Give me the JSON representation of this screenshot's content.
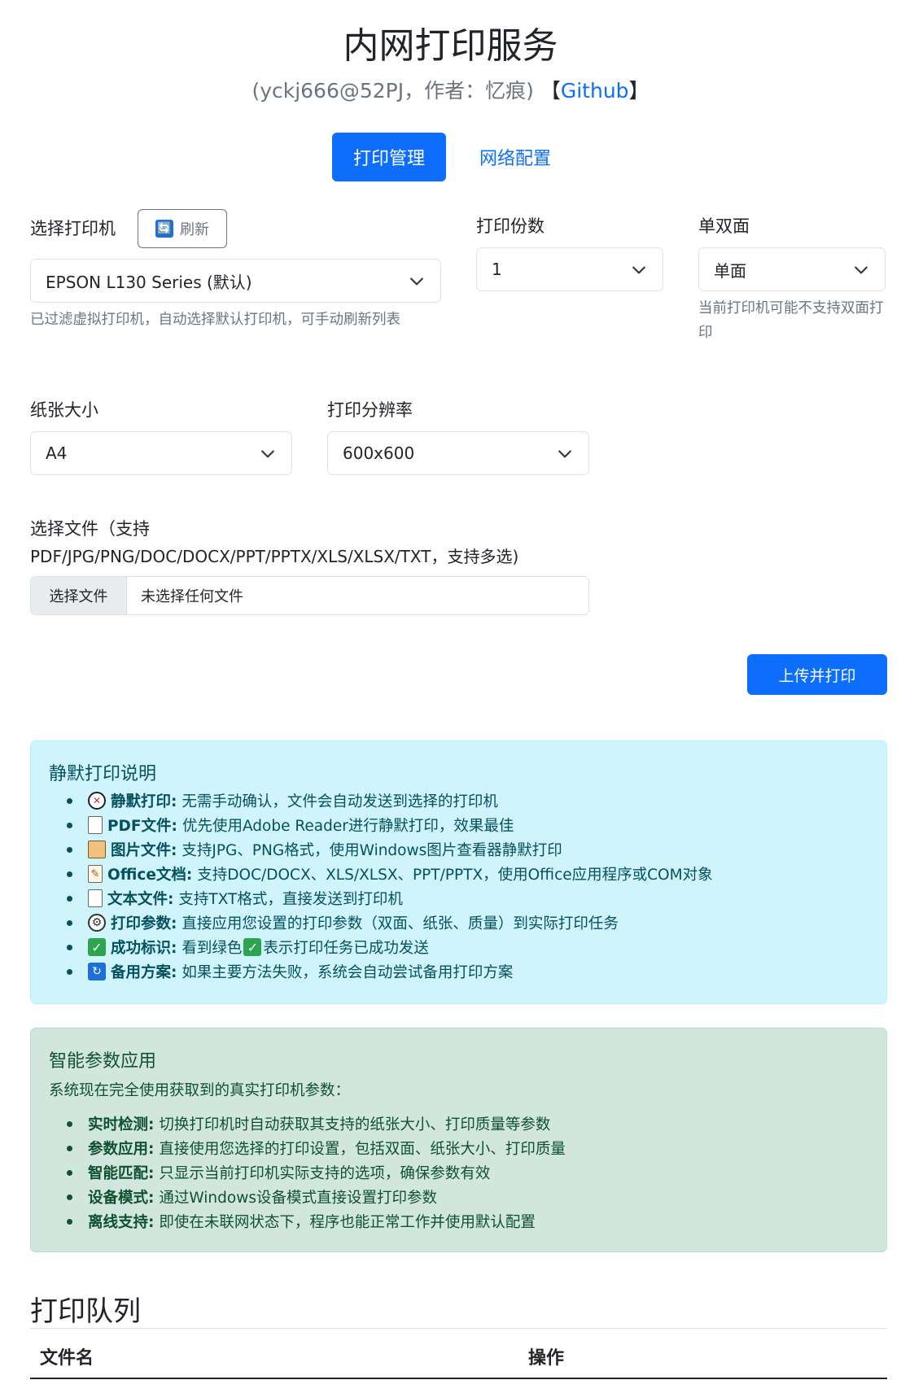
{
  "header": {
    "title": "内网打印服务",
    "subtitle_prefix": "(yckj666@52PJ，作者：忆痕)",
    "bracket_open": "【",
    "github_link": "Github",
    "bracket_close": "】"
  },
  "tabs": [
    {
      "label": "打印管理",
      "active": true
    },
    {
      "label": "网络配置",
      "active": false
    }
  ],
  "form": {
    "printer_label": "选择打印机",
    "refresh_label": "刷新",
    "refresh_icon": "🔄",
    "printer_value": "EPSON L130 Series (默认)",
    "printer_hint": "已过滤虚拟打印机，自动选择默认打印机，可手动刷新列表",
    "copies_label": "打印份数",
    "copies_value": "1",
    "duplex_label": "单双面",
    "duplex_value": "单面",
    "duplex_hint": "当前打印机可能不支持双面打印",
    "paper_label": "纸张大小",
    "paper_value": "A4",
    "resolution_label": "打印分辨率",
    "resolution_value": "600x600",
    "file_label_line1": "选择文件（支持",
    "file_label_line2": "PDF/JPG/PNG/DOC/DOCX/PPT/PPTX/XLS/XLSX/TXT，支持多选)",
    "file_button": "选择文件",
    "file_status": "未选择任何文件",
    "upload_button": "上传并打印"
  },
  "info_alert": {
    "title": "静默打印说明",
    "items": [
      {
        "icon": "mute-icon",
        "bold": "静默打印:",
        "text": "无需手动确认，文件会自动发送到选择的打印机"
      },
      {
        "icon": "document-icon",
        "bold": "PDF文件:",
        "text": "优先使用Adobe Reader进行静默打印，效果最佳"
      },
      {
        "icon": "picture-icon",
        "bold": "图片文件:",
        "text": "支持JPG、PNG格式，使用Windows图片查看器静默打印"
      },
      {
        "icon": "memo-icon",
        "bold": "Office文档:",
        "text": "支持DOC/DOCX、XLS/XLSX、PPT/PPTX，使用Office应用程序或COM对象"
      },
      {
        "icon": "document-icon",
        "bold": "文本文件:",
        "text": "支持TXT格式，直接发送到打印机"
      },
      {
        "icon": "gear-icon",
        "bold": "打印参数:",
        "text": "直接应用您设置的打印参数（双面、纸张、质量）到实际打印任务"
      },
      {
        "icon": "check-icon",
        "bold": "成功标识:",
        "text_before": "看到绿色",
        "text_after": "表示打印任务已成功发送"
      },
      {
        "icon": "refresh-icon",
        "bold": "备用方案:",
        "text": "如果主要方法失败，系统会自动尝试备用打印方案"
      }
    ]
  },
  "success_alert": {
    "title": "智能参数应用",
    "intro": "系统现在完全使用获取到的真实打印机参数：",
    "items": [
      {
        "bold": "实时检测:",
        "text": "切换打印机时自动获取其支持的纸张大小、打印质量等参数"
      },
      {
        "bold": "参数应用:",
        "text": "直接使用您选择的打印设置，包括双面、纸张大小、打印质量"
      },
      {
        "bold": "智能匹配:",
        "text": "只显示当前打印机实际支持的选项，确保参数有效"
      },
      {
        "bold": "设备模式:",
        "text": "通过Windows设备模式直接设置打印参数"
      },
      {
        "bold": "离线支持:",
        "text": "即使在未联网状态下，程序也能正常工作并使用默认配置"
      }
    ]
  },
  "queue": {
    "title": "打印队列",
    "columns": [
      "文件名",
      "操作"
    ]
  }
}
